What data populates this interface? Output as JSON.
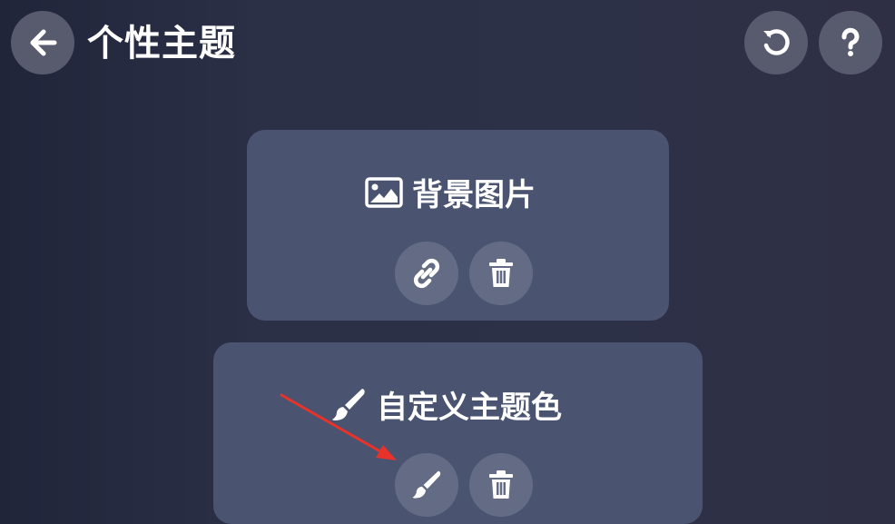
{
  "header": {
    "title": "个性主题",
    "back_icon": "arrow-left-icon",
    "reset_icon": "undo-icon",
    "help_icon": "question-icon"
  },
  "cards": [
    {
      "title": "背景图片",
      "icon": "image-icon",
      "actions": [
        "link-icon",
        "trash-icon"
      ]
    },
    {
      "title": "自定义主题色",
      "icon": "paintbrush-icon",
      "actions": [
        "paintbrush-icon",
        "trash-icon"
      ]
    }
  ],
  "colors": {
    "background": "#2c3047",
    "card": "#4a5470",
    "button": "#646c85",
    "annotation_arrow": "#e8332b"
  }
}
